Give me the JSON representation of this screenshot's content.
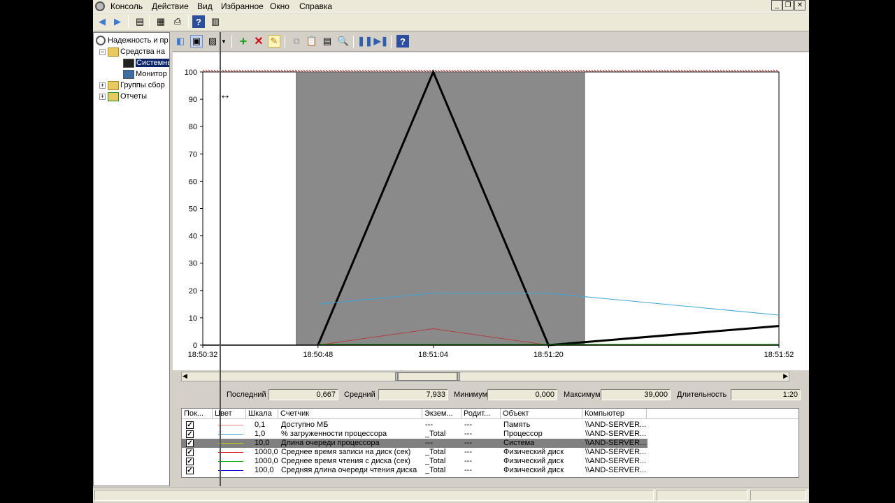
{
  "menu": [
    "Консоль",
    "Действие",
    "Вид",
    "Избранное",
    "Окно",
    "Справка"
  ],
  "tree": {
    "items": [
      {
        "label": "Надежность и пр",
        "indent": 0,
        "expander": "",
        "selected": false
      },
      {
        "label": "Средства на",
        "indent": 1,
        "expander": "−",
        "selected": false
      },
      {
        "label": "Системны",
        "indent": 2,
        "expander": "",
        "selected": true
      },
      {
        "label": "Монитор",
        "indent": 2,
        "expander": "",
        "selected": false
      },
      {
        "label": "Группы сбор",
        "indent": 1,
        "expander": "+",
        "selected": false
      },
      {
        "label": "Отчеты",
        "indent": 1,
        "expander": "+",
        "selected": false
      }
    ]
  },
  "stats": {
    "last_label": "Последний",
    "last_value": "0,667",
    "avg_label": "Средний",
    "avg_value": "7,933",
    "min_label": "Минимум",
    "min_value": "0,000",
    "max_label": "Максимум",
    "max_value": "39,000",
    "dur_label": "Длительность",
    "dur_value": "1:20"
  },
  "legend": {
    "columns": [
      "Пок...",
      "Цвет",
      "Шкала",
      "Счетчик",
      "Экзем...",
      "Родит...",
      "Объект",
      "Компьютер"
    ],
    "rows": [
      {
        "color": "#e08080",
        "scale": "0,1",
        "counter": "Доступно МБ",
        "instance": "---",
        "parent": "---",
        "object": "Память",
        "computer": "\\\\AND-SERVER...",
        "selected": false
      },
      {
        "color": "#3fa7d6",
        "scale": "1,0",
        "counter": "% загруженности процессора",
        "instance": "_Total",
        "parent": "---",
        "object": "Процессор",
        "computer": "\\\\AND-SERVER...",
        "selected": false
      },
      {
        "color": "#c8c800",
        "scale": "10,0",
        "counter": "Длина очереди процессора",
        "instance": "---",
        "parent": "---",
        "object": "Система",
        "computer": "\\\\AND-SERVER...",
        "selected": true
      },
      {
        "color": "#cc0000",
        "scale": "1000,0",
        "counter": "Среднее время записи на диск (сек)",
        "instance": "_Total",
        "parent": "---",
        "object": "Физический диск",
        "computer": "\\\\AND-SERVER...",
        "selected": false
      },
      {
        "color": "#00aa00",
        "scale": "1000,0",
        "counter": "Среднее время чтения с диска (сек)",
        "instance": "_Total",
        "parent": "---",
        "object": "Физический диск",
        "computer": "\\\\AND-SERVER...",
        "selected": false
      },
      {
        "color": "#0000cc",
        "scale": "100,0",
        "counter": "Средняя длина очереди чтения диска",
        "instance": "_Total",
        "parent": "---",
        "object": "Физический диск",
        "computer": "\\\\AND-SERVER...",
        "selected": false
      }
    ]
  },
  "chart_data": {
    "type": "line",
    "ylim": [
      0,
      100
    ],
    "y_ticks": [
      0,
      10,
      20,
      30,
      40,
      50,
      60,
      70,
      80,
      90,
      100
    ],
    "x_tick_labels": [
      "18:50:32",
      "18:50:48",
      "18:51:04",
      "18:51:20",
      "18:51:52"
    ],
    "x_tick_seconds": [
      0,
      16,
      32,
      48,
      80
    ],
    "xlim_seconds": [
      0,
      80
    ],
    "highlight_range_seconds": [
      13,
      53
    ],
    "series": [
      {
        "color": "#000000",
        "bold": true,
        "x": [
          16,
          32,
          48,
          80
        ],
        "y": [
          0,
          100,
          0,
          7
        ]
      },
      {
        "color": "#3fa7d6",
        "bold": false,
        "x": [
          16,
          32,
          48,
          80
        ],
        "y": [
          15,
          19,
          19,
          11
        ]
      },
      {
        "color": "#b04040",
        "bold": false,
        "x": [
          16,
          32,
          48,
          80
        ],
        "y": [
          0,
          6,
          0,
          0
        ]
      },
      {
        "color": "#00aa00",
        "bold": false,
        "x": [
          16,
          32,
          48,
          80
        ],
        "y": [
          0.3,
          0.3,
          0.3,
          0.3
        ]
      }
    ]
  }
}
